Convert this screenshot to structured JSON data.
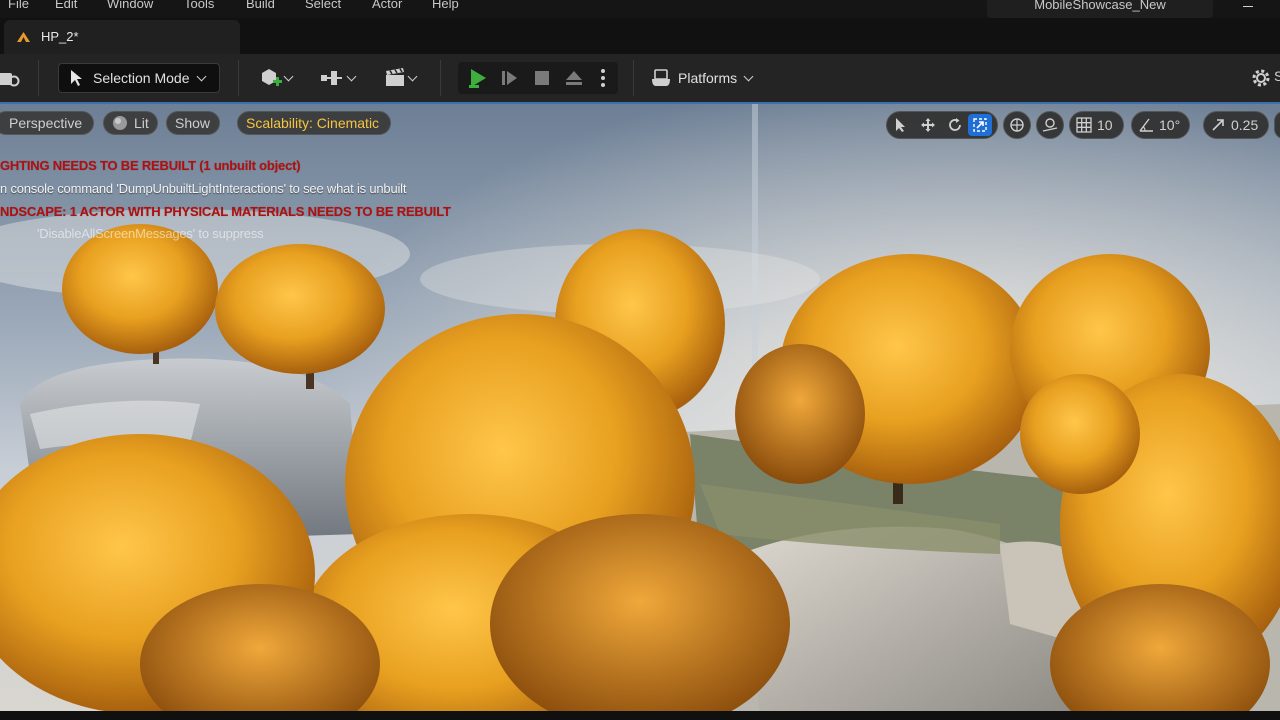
{
  "menu": {
    "items": [
      "File",
      "Edit",
      "Window",
      "Tools",
      "Build",
      "Select",
      "Actor",
      "Help"
    ],
    "project_name": "MobileShowcase_New"
  },
  "tabs": [
    {
      "label": "HP_2*",
      "icon": "level-icon"
    }
  ],
  "toolbar": {
    "selection_mode_label": "Selection Mode",
    "platforms_label": "Platforms",
    "icons": [
      "camera-icon",
      "selection-mode-icon",
      "add-actor-icon",
      "blueprint-icon",
      "cinematics-icon",
      "play-icon",
      "step-icon",
      "stop-icon",
      "eject-icon",
      "more-options-icon",
      "platforms-icon",
      "settings-icon"
    ]
  },
  "viewport": {
    "perspective_label": "Perspective",
    "lit_label": "Lit",
    "show_label": "Show",
    "scalability_label": "Scalability: Cinematic",
    "grid_snap_value": "10",
    "rotation_snap_value": "10°",
    "scale_snap_value": "0.25",
    "messages": {
      "lighting": "GHTING NEEDS TO BE REBUILT (1 unbuilt object)",
      "console": "n console command 'DumpUnbuiltLightInteractions' to see what is unbuilt",
      "landscape": "NDSCAPE: 1 ACTOR WITH PHYSICAL MATERIALS NEEDS TO BE REBUILT",
      "suppress": "'DisableAllScreenMessages' to suppress"
    }
  },
  "colors": {
    "accent": "#1f6fd6",
    "play_green": "#3fae3f",
    "scalability_yellow": "#f5c542",
    "warning_red": "#b30f0f",
    "foliage_orange": "#e8a020"
  }
}
